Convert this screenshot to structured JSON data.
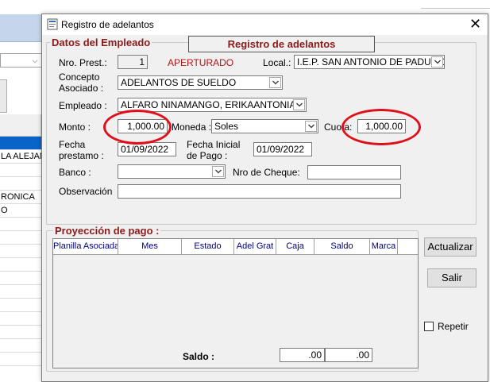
{
  "background_window": {
    "grid_rows": [
      "",
      "LA ALEJAN",
      "",
      "",
      "RONICA",
      "O",
      "",
      "",
      "",
      "",
      "",
      "",
      "",
      "",
      "",
      "",
      ""
    ]
  },
  "dialog": {
    "title": "Registro de adelantos",
    "close_glyph": "✕",
    "banner": "Registro de adelantos",
    "employee_section": {
      "legend": "Datos del Empleado",
      "nro_prest_label": "Nro. Prest.:",
      "nro_prest_value": "1",
      "status": "APERTURADO",
      "local_label": "Local.:",
      "local_value": "I.E.P. SAN ANTONIO DE PADUA D",
      "concepto_label_1": "Concepto",
      "concepto_label_2": "Asociado :",
      "concepto_value": "ADELANTOS DE SUELDO",
      "empleado_label": "Empleado :",
      "empleado_value": "ALFARO NINAMANGO, ERIKAANTONIA",
      "monto_label": "Monto :",
      "monto_value": "1,000.00",
      "moneda_label": "Moneda :",
      "moneda_value": "Soles",
      "cuota_label": "Cuota:",
      "cuota_value": "1,000.00",
      "fecha_prestamo_label_1": "Fecha",
      "fecha_prestamo_label_2": "prestamo :",
      "fecha_prestamo_value": "01/09/2022",
      "fecha_inicial_label_1": "Fecha Inicial",
      "fecha_inicial_label_2": "de Pago :",
      "fecha_inicial_value": "01/09/2022",
      "banco_label": "Banco :",
      "banco_value": "",
      "nro_cheque_label": "Nro de Cheque:",
      "nro_cheque_value": "",
      "observacion_label": "Observación",
      "observacion_value": ""
    },
    "projection_section": {
      "legend": "Proyección de pago :",
      "columns": [
        "Planilla Asociada",
        "Mes",
        "Estado",
        "Adel Grat",
        "Caja",
        "Saldo",
        "Marca"
      ],
      "saldo_label": "Saldo :",
      "saldo_value_1": ".00",
      "saldo_value_2": ".00"
    },
    "buttons": {
      "actualizar": "Actualizar",
      "salir": "Salir"
    },
    "repetir_label": "Repetir",
    "repetir_checked": false,
    "annotation_color": "#e0101a",
    "accent_color": "#8b1a1a"
  }
}
